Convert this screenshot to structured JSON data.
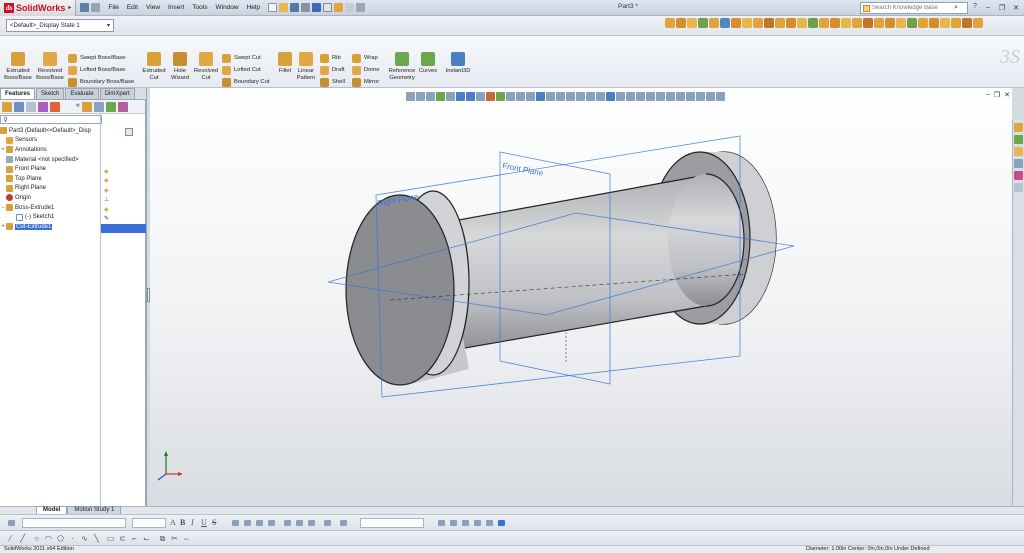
{
  "app": {
    "name": "SolidWorks",
    "document_title": "Part3 *",
    "menu": [
      "File",
      "Edit",
      "View",
      "Insert",
      "Tools",
      "Window",
      "Help"
    ],
    "search_placeholder": "Search Knowledge Base",
    "help_label": "?"
  },
  "config_dropdown": {
    "value": "<Default>_Display State 1"
  },
  "ribbon": {
    "buttons": [
      {
        "label": "Extruded\nBoss/Base",
        "icon": "extruded-boss-icon",
        "color": "#d9a13a"
      },
      {
        "label": "Revolved\nBoss/Base",
        "icon": "revolved-boss-icon",
        "color": "#d9a13a"
      },
      {
        "label": "Extruded\nCut",
        "icon": "extruded-cut-icon",
        "color": "#d9a13a"
      },
      {
        "label": "Hole\nWizard",
        "icon": "hole-wizard-icon",
        "color": "#d9a13a"
      },
      {
        "label": "Revolved\nCut",
        "icon": "revolved-cut-icon",
        "color": "#d9a13a"
      },
      {
        "label": "Fillet",
        "icon": "fillet-icon",
        "color": "#d9a13a"
      },
      {
        "label": "Linear\nPattern",
        "icon": "linear-pattern-icon",
        "color": "#d9a13a"
      },
      {
        "label": "Reference\nGeometry",
        "icon": "reference-geometry-icon",
        "color": "#6aa84f"
      },
      {
        "label": "Curves",
        "icon": "curves-icon",
        "color": "#6aa84f"
      },
      {
        "label": "Instant3D",
        "icon": "instant3d-icon",
        "color": "#4a7fc2"
      }
    ],
    "small_buttons": [
      {
        "label": "Swept Boss/Base",
        "icon": "swept-boss-icon",
        "color": "#d9a13a"
      },
      {
        "label": "Lofted Boss/Base",
        "icon": "lofted-boss-icon",
        "color": "#d9a13a"
      },
      {
        "label": "Boundary Boss/Base",
        "icon": "boundary-boss-icon",
        "color": "#d9a13a"
      },
      {
        "label": "Swept Cut",
        "icon": "swept-cut-icon",
        "color": "#d9a13a"
      },
      {
        "label": "Lofted Cut",
        "icon": "lofted-cut-icon",
        "color": "#d9a13a"
      },
      {
        "label": "Boundary Cut",
        "icon": "boundary-cut-icon",
        "color": "#d9a13a"
      },
      {
        "label": "Rib",
        "icon": "rib-icon",
        "color": "#d9a13a"
      },
      {
        "label": "Draft",
        "icon": "draft-icon",
        "color": "#d9a13a"
      },
      {
        "label": "Shell",
        "icon": "shell-icon",
        "color": "#d9a13a"
      },
      {
        "label": "Wrap",
        "icon": "wrap-icon",
        "color": "#d9a13a"
      },
      {
        "label": "Dome",
        "icon": "dome-icon",
        "color": "#d9a13a"
      },
      {
        "label": "Mirror",
        "icon": "mirror-icon",
        "color": "#d9a13a"
      }
    ]
  },
  "panel_tabs": [
    "Features",
    "Sketch",
    "Evaluate",
    "DimXpert"
  ],
  "feature_tree": {
    "root": "Part3  (Default<<Default>_Disp",
    "items": [
      {
        "label": "Sensors",
        "icon": "sensors-icon",
        "expander": ""
      },
      {
        "label": "Annotations",
        "icon": "annotations-icon",
        "expander": "+"
      },
      {
        "label": "Material <not specified>",
        "icon": "material-icon",
        "expander": ""
      },
      {
        "label": "Front Plane",
        "icon": "plane-icon",
        "expander": ""
      },
      {
        "label": "Top Plane",
        "icon": "plane-icon",
        "expander": ""
      },
      {
        "label": "Right Plane",
        "icon": "plane-icon",
        "expander": ""
      },
      {
        "label": "Origin",
        "icon": "origin-icon",
        "expander": ""
      },
      {
        "label": "Boss-Extrude1",
        "icon": "boss-extrude-icon",
        "expander": "−"
      },
      {
        "label": "(-) Sketch1",
        "icon": "sketch-icon",
        "expander": ""
      },
      {
        "label": "Cut-Extrude1",
        "icon": "cut-extrude-icon",
        "expander": "+"
      }
    ]
  },
  "viewport": {
    "plane_labels": {
      "front": "Front Plane",
      "right": "Right Plane"
    }
  },
  "bottom_tabs": [
    "Model",
    "Motion Study 1"
  ],
  "status": {
    "left": "SolidWorks 2011 x64 Edition",
    "right": "Diameter: 1.00in  Center: 0in,0in,0in   Under Defined"
  },
  "colors": {
    "accent_blue": "#3c6fd6",
    "plane_blue": "#2f6fd8",
    "model_gray": "#8a8c90"
  }
}
